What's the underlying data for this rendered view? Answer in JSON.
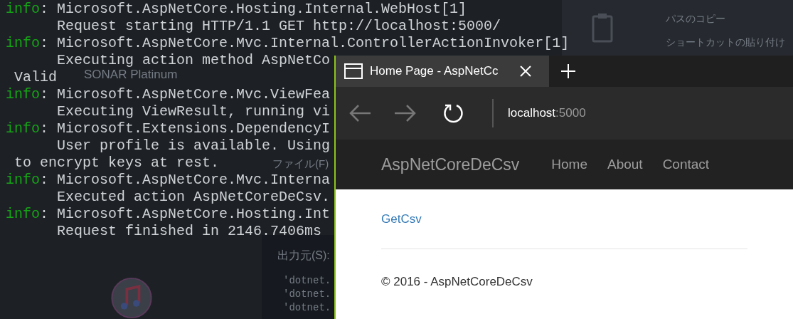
{
  "desktop": {
    "labels": [
      {
        "text": "SONAR Platinum"
      },
      {
        "text": "ファイル(F)"
      },
      {
        "text": "出力元(S):"
      },
      {
        "text": "'dotnet."
      },
      {
        "text": "'dotnet."
      },
      {
        "text": "'dotnet."
      },
      {
        "text": "パスのコピー"
      },
      {
        "text": "ショートカットの貼り付け"
      }
    ]
  },
  "console": {
    "lines": [
      {
        "kind": "info",
        "level": "info",
        "sep": ":",
        "text": "Microsoft.AspNetCore.Hosting.Internal.WebHost[1]"
      },
      {
        "kind": "cont",
        "text": "Request starting HTTP/1.1 GET http://localhost:5000/"
      },
      {
        "kind": "info",
        "level": "info",
        "sep": ":",
        "text": "Microsoft.AspNetCore.Mvc.Internal.ControllerActionInvoker[1]"
      },
      {
        "kind": "cont",
        "text": "Executing action method AspNetCo"
      },
      {
        "kind": "wrap",
        "text": "Valid"
      },
      {
        "kind": "info",
        "level": "info",
        "sep": ":",
        "text": "Microsoft.AspNetCore.Mvc.ViewFea"
      },
      {
        "kind": "cont",
        "text": "Executing ViewResult, running vi"
      },
      {
        "kind": "info",
        "level": "info",
        "sep": ":",
        "text": "Microsoft.Extensions.DependencyI"
      },
      {
        "kind": "cont",
        "text": "User profile is available. Using"
      },
      {
        "kind": "wrap",
        "text": "to encrypt keys at rest."
      },
      {
        "kind": "info",
        "level": "info",
        "sep": ":",
        "text": "Microsoft.AspNetCore.Mvc.Interna"
      },
      {
        "kind": "cont",
        "text": "Executed action AspNetCoreDeCsv."
      },
      {
        "kind": "info",
        "level": "info",
        "sep": ":",
        "text": "Microsoft.AspNetCore.Hosting.Int"
      },
      {
        "kind": "cont",
        "text": "Request finished in 2146.7406ms"
      }
    ]
  },
  "browser": {
    "tab": {
      "title": "Home Page - AspNetCc"
    },
    "address": {
      "host": "localhost",
      "port": ":5000"
    },
    "navbar": {
      "brand": "AspNetCoreDeCsv",
      "links": [
        "Home",
        "About",
        "Contact"
      ]
    },
    "page": {
      "link": "GetCsv",
      "footer": "© 2016 - AspNetCoreDeCsv"
    }
  }
}
